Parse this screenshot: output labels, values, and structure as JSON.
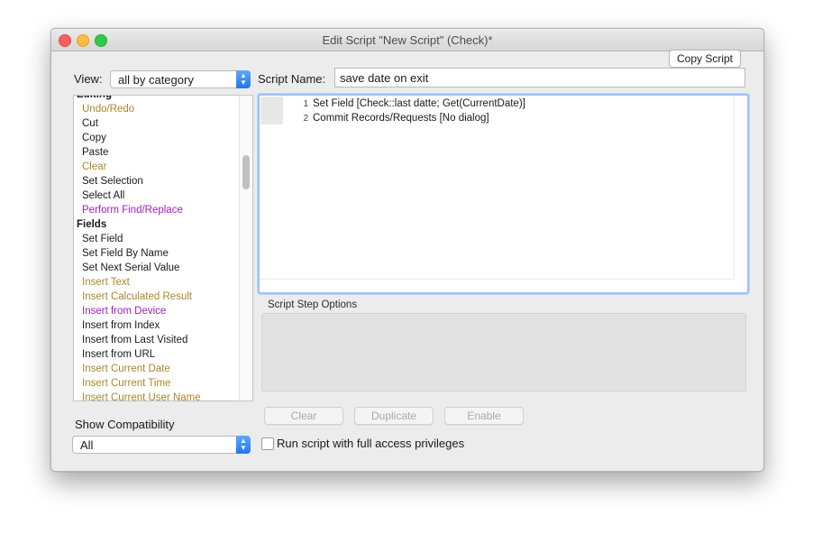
{
  "window": {
    "title": "Edit Script \"New Script\" (Check)*"
  },
  "toolbar": {
    "copy_script_label": "Copy Script"
  },
  "view": {
    "label": "View:",
    "selected": "all by category"
  },
  "script_name": {
    "label": "Script Name:",
    "value": "save date on exit"
  },
  "steps_list": {
    "items": [
      {
        "label": "Editing",
        "kind": "heading",
        "color": "#1a1a1a"
      },
      {
        "label": "Undo/Redo",
        "kind": "step",
        "color": "#a8882d"
      },
      {
        "label": "Cut",
        "kind": "step",
        "color": "#1a1a1a"
      },
      {
        "label": "Copy",
        "kind": "step",
        "color": "#1a1a1a"
      },
      {
        "label": "Paste",
        "kind": "step",
        "color": "#1a1a1a"
      },
      {
        "label": "Clear",
        "kind": "step",
        "color": "#a8882d"
      },
      {
        "label": "Set Selection",
        "kind": "step",
        "color": "#1a1a1a"
      },
      {
        "label": "Select All",
        "kind": "step",
        "color": "#1a1a1a"
      },
      {
        "label": "Perform Find/Replace",
        "kind": "step",
        "color": "#a020c0"
      },
      {
        "label": "Fields",
        "kind": "heading",
        "color": "#1a1a1a"
      },
      {
        "label": "Set Field",
        "kind": "step",
        "color": "#1a1a1a"
      },
      {
        "label": "Set Field By Name",
        "kind": "step",
        "color": "#1a1a1a"
      },
      {
        "label": "Set Next Serial Value",
        "kind": "step",
        "color": "#1a1a1a"
      },
      {
        "label": "Insert Text",
        "kind": "step",
        "color": "#a8882d"
      },
      {
        "label": "Insert Calculated Result",
        "kind": "step",
        "color": "#a8882d"
      },
      {
        "label": "Insert from Device",
        "kind": "step",
        "color": "#a020c0"
      },
      {
        "label": "Insert from Index",
        "kind": "step",
        "color": "#1a1a1a"
      },
      {
        "label": "Insert from Last Visited",
        "kind": "step",
        "color": "#1a1a1a"
      },
      {
        "label": "Insert from URL",
        "kind": "step",
        "color": "#1a1a1a"
      },
      {
        "label": "Insert Current Date",
        "kind": "step",
        "color": "#a8882d"
      },
      {
        "label": "Insert Current Time",
        "kind": "step",
        "color": "#a8882d"
      },
      {
        "label": "Insert Current User Name",
        "kind": "step",
        "color": "#a8882d"
      }
    ]
  },
  "script": {
    "lines": [
      {
        "num": "1",
        "text": "Set Field [Check::last datte; Get(CurrentDate)]"
      },
      {
        "num": "2",
        "text": "Commit Records/Requests [No dialog]"
      }
    ]
  },
  "options": {
    "label": "Script Step Options"
  },
  "actions": {
    "clear_label": "Clear",
    "duplicate_label": "Duplicate",
    "enable_label": "Enable"
  },
  "compat": {
    "label": "Show Compatibility",
    "selected": "All"
  },
  "full_access": {
    "label": "Run script with full access privileges",
    "checked": false
  }
}
